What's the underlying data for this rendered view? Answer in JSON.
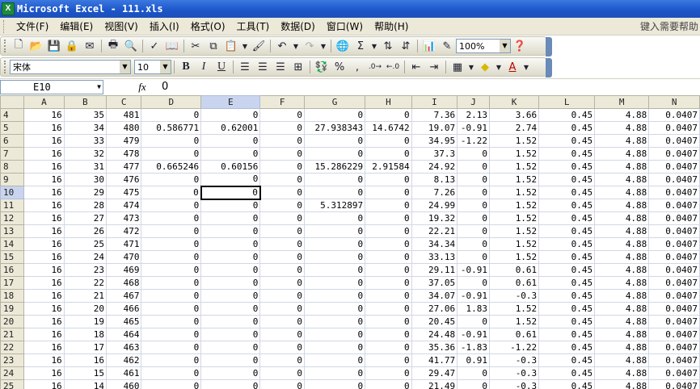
{
  "window": {
    "title": "Microsoft Excel - 111.xls",
    "app_icon": "excel-icon"
  },
  "menu": {
    "items": [
      "文件(F)",
      "编辑(E)",
      "视图(V)",
      "插入(I)",
      "格式(O)",
      "工具(T)",
      "数据(D)",
      "窗口(W)",
      "帮助(H)"
    ],
    "help_placeholder": "键入需要帮助"
  },
  "toolbar": {
    "zoom": "100%",
    "font_name": "宋体",
    "font_size": "10",
    "bold": "B",
    "italic": "I",
    "underline": "U",
    "percent": "%",
    "comma": ",",
    "sum": "Σ"
  },
  "formula_bar": {
    "name_box": "E10",
    "fx": "fx",
    "value": "0"
  },
  "grid": {
    "active_cell": "E10",
    "columns": [
      "A",
      "B",
      "C",
      "D",
      "E",
      "F",
      "G",
      "H",
      "I",
      "J",
      "K",
      "L",
      "M",
      "N"
    ],
    "rows": [
      {
        "n": "4",
        "cells": [
          "16",
          "35",
          "481",
          "0",
          "0",
          "0",
          "0",
          "0",
          "7.36",
          "2.13",
          "3.66",
          "0.45",
          "4.88",
          "0.0407"
        ]
      },
      {
        "n": "5",
        "cells": [
          "16",
          "34",
          "480",
          "0.586771",
          "0.62001",
          "0",
          "27.938343",
          "14.6742",
          "19.07",
          "-0.91",
          "2.74",
          "0.45",
          "4.88",
          "0.0407"
        ]
      },
      {
        "n": "6",
        "cells": [
          "16",
          "33",
          "479",
          "0",
          "0",
          "0",
          "0",
          "0",
          "34.95",
          "-1.22",
          "1.52",
          "0.45",
          "4.88",
          "0.0407"
        ]
      },
      {
        "n": "7",
        "cells": [
          "16",
          "32",
          "478",
          "0",
          "0",
          "0",
          "0",
          "0",
          "37.3",
          "0",
          "1.52",
          "0.45",
          "4.88",
          "0.0407"
        ]
      },
      {
        "n": "8",
        "cells": [
          "16",
          "31",
          "477",
          "0.665246",
          "0.60156",
          "0",
          "15.286229",
          "2.91584",
          "24.92",
          "0",
          "1.52",
          "0.45",
          "4.88",
          "0.0407"
        ]
      },
      {
        "n": "9",
        "cells": [
          "16",
          "30",
          "476",
          "0",
          "0",
          "0",
          "0",
          "0",
          "8.13",
          "0",
          "1.52",
          "0.45",
          "4.88",
          "0.0407"
        ]
      },
      {
        "n": "10",
        "cells": [
          "16",
          "29",
          "475",
          "0",
          "0",
          "0",
          "0",
          "0",
          "7.26",
          "0",
          "1.52",
          "0.45",
          "4.88",
          "0.0407"
        ]
      },
      {
        "n": "11",
        "cells": [
          "16",
          "28",
          "474",
          "0",
          "0",
          "0",
          "5.312897",
          "0",
          "24.99",
          "0",
          "1.52",
          "0.45",
          "4.88",
          "0.0407"
        ]
      },
      {
        "n": "12",
        "cells": [
          "16",
          "27",
          "473",
          "0",
          "0",
          "0",
          "0",
          "0",
          "19.32",
          "0",
          "1.52",
          "0.45",
          "4.88",
          "0.0407"
        ]
      },
      {
        "n": "13",
        "cells": [
          "16",
          "26",
          "472",
          "0",
          "0",
          "0",
          "0",
          "0",
          "22.21",
          "0",
          "1.52",
          "0.45",
          "4.88",
          "0.0407"
        ]
      },
      {
        "n": "14",
        "cells": [
          "16",
          "25",
          "471",
          "0",
          "0",
          "0",
          "0",
          "0",
          "34.34",
          "0",
          "1.52",
          "0.45",
          "4.88",
          "0.0407"
        ]
      },
      {
        "n": "15",
        "cells": [
          "16",
          "24",
          "470",
          "0",
          "0",
          "0",
          "0",
          "0",
          "33.13",
          "0",
          "1.52",
          "0.45",
          "4.88",
          "0.0407"
        ]
      },
      {
        "n": "16",
        "cells": [
          "16",
          "23",
          "469",
          "0",
          "0",
          "0",
          "0",
          "0",
          "29.11",
          "-0.91",
          "0.61",
          "0.45",
          "4.88",
          "0.0407"
        ]
      },
      {
        "n": "17",
        "cells": [
          "16",
          "22",
          "468",
          "0",
          "0",
          "0",
          "0",
          "0",
          "37.05",
          "0",
          "0.61",
          "0.45",
          "4.88",
          "0.0407"
        ]
      },
      {
        "n": "18",
        "cells": [
          "16",
          "21",
          "467",
          "0",
          "0",
          "0",
          "0",
          "0",
          "34.07",
          "-0.91",
          "-0.3",
          "0.45",
          "4.88",
          "0.0407"
        ]
      },
      {
        "n": "19",
        "cells": [
          "16",
          "20",
          "466",
          "0",
          "0",
          "0",
          "0",
          "0",
          "27.06",
          "1.83",
          "1.52",
          "0.45",
          "4.88",
          "0.0407"
        ]
      },
      {
        "n": "20",
        "cells": [
          "16",
          "19",
          "465",
          "0",
          "0",
          "0",
          "0",
          "0",
          "20.45",
          "0",
          "1.52",
          "0.45",
          "4.88",
          "0.0407"
        ]
      },
      {
        "n": "21",
        "cells": [
          "16",
          "18",
          "464",
          "0",
          "0",
          "0",
          "0",
          "0",
          "24.48",
          "-0.91",
          "0.61",
          "0.45",
          "4.88",
          "0.0407"
        ]
      },
      {
        "n": "22",
        "cells": [
          "16",
          "17",
          "463",
          "0",
          "0",
          "0",
          "0",
          "0",
          "35.36",
          "-1.83",
          "-1.22",
          "0.45",
          "4.88",
          "0.0407"
        ]
      },
      {
        "n": "23",
        "cells": [
          "16",
          "16",
          "462",
          "0",
          "0",
          "0",
          "0",
          "0",
          "41.77",
          "0.91",
          "-0.3",
          "0.45",
          "4.88",
          "0.0407"
        ]
      },
      {
        "n": "24",
        "cells": [
          "16",
          "15",
          "461",
          "0",
          "0",
          "0",
          "0",
          "0",
          "29.47",
          "0",
          "-0.3",
          "0.45",
          "4.88",
          "0.0407"
        ]
      },
      {
        "n": "25",
        "cells": [
          "16",
          "14",
          "460",
          "0",
          "0",
          "0",
          "0",
          "0",
          "21.49",
          "0",
          "-0.3",
          "0.45",
          "4.88",
          "0.0407"
        ]
      }
    ]
  }
}
